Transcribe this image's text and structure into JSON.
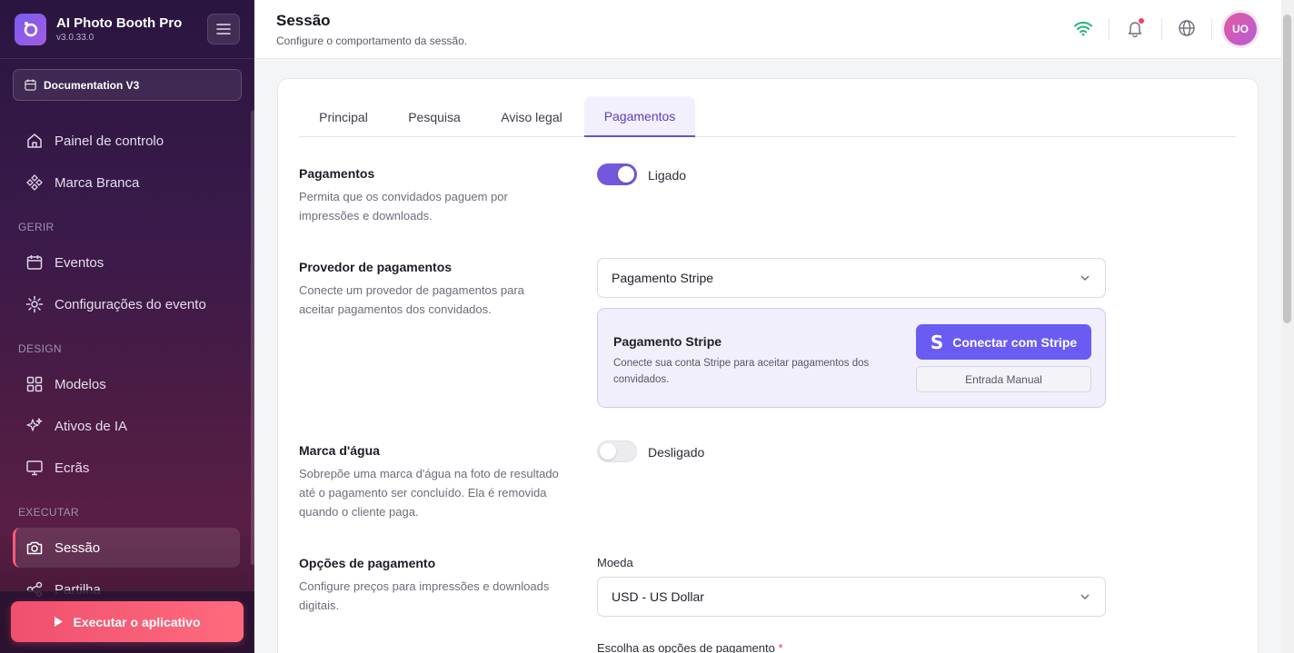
{
  "app": {
    "name": "AI Photo Booth Pro",
    "version": "v3.0.33.0"
  },
  "workspace": {
    "label": "Documentation V3"
  },
  "sidebar": {
    "items": [
      {
        "label": "Painel de controlo"
      },
      {
        "label": "Marca Branca"
      },
      {
        "label": "Eventos"
      },
      {
        "label": "Configurações do evento"
      },
      {
        "label": "Modelos"
      },
      {
        "label": "Ativos de IA"
      },
      {
        "label": "Ecrãs"
      },
      {
        "label": "Sessão"
      },
      {
        "label": "Partilha"
      }
    ],
    "sections": {
      "manage": "GERIR",
      "design": "DESIGN",
      "run": "EXECUTAR"
    },
    "run_button": "Executar o aplicativo"
  },
  "header": {
    "title": "Sessão",
    "subtitle": "Configure o comportamento da sessão.",
    "avatar_initials": "UO"
  },
  "tabs": [
    {
      "label": "Principal"
    },
    {
      "label": "Pesquisa"
    },
    {
      "label": "Aviso legal"
    },
    {
      "label": "Pagamentos"
    }
  ],
  "payments": {
    "label": "Pagamentos",
    "description": "Permita que os convidados paguem por impressões e downloads.",
    "toggle_state": "Ligado",
    "enabled": true
  },
  "provider": {
    "label": "Provedor de pagamentos",
    "description": "Conecte um provedor de pagamentos para aceitar pagamentos dos convidados.",
    "selected": "Pagamento Stripe",
    "box_title": "Pagamento Stripe",
    "box_description": "Conecte sua conta Stripe para aceitar pagamentos dos convidados.",
    "connect_button": "Conectar com Stripe",
    "manual_button": "Entrada Manual"
  },
  "watermark": {
    "label": "Marca d'água",
    "description": "Sobrepõe uma marca d'água na foto de resultado até o pagamento ser concluído. Ela é removida quando o cliente paga.",
    "toggle_state": "Desligado",
    "enabled": false
  },
  "options": {
    "label": "Opções de pagamento",
    "description": "Configure preços para impressões e downloads digitais.",
    "currency_label": "Moeda",
    "currency_value": "USD - US Dollar",
    "choose_label": "Escolha as opções de pagamento",
    "required_mark": "*"
  },
  "colors": {
    "accent": "#6a4fd6",
    "run": "#f0506e",
    "wifi": "#22b573"
  }
}
